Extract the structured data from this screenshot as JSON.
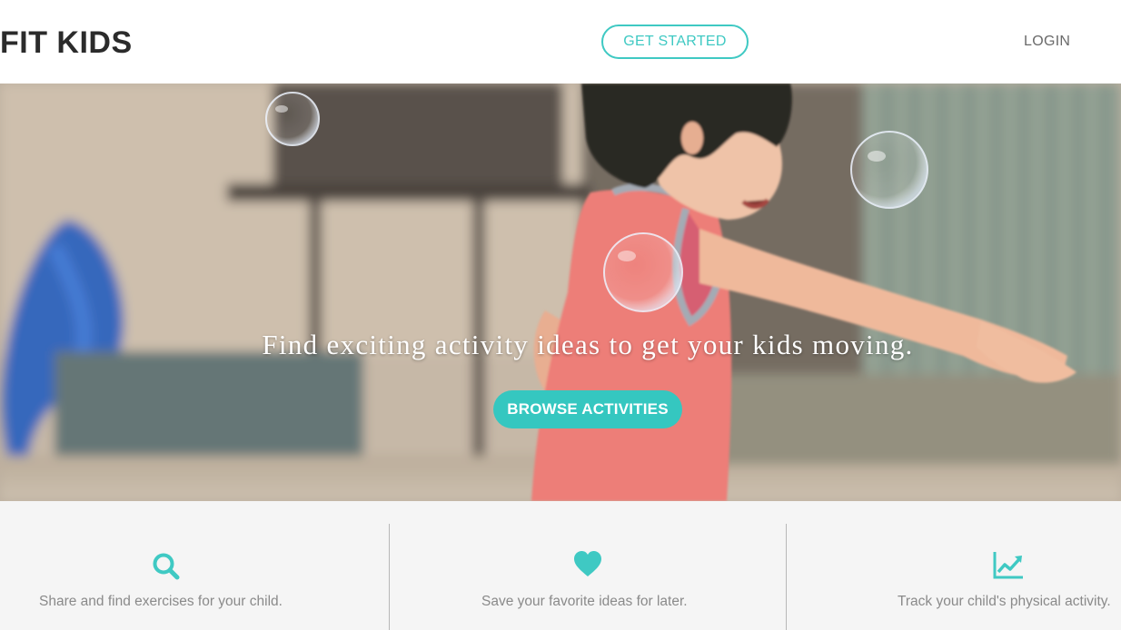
{
  "header": {
    "brand": "FIT KIDS",
    "get_started_label": "GET STARTED",
    "login_label": "LOGIN"
  },
  "hero": {
    "title": "Find exciting activity ideas to get your kids moving.",
    "browse_label": "BROWSE ACTIVITIES"
  },
  "features": [
    {
      "icon": "search-icon",
      "text": "Share and find exercises for your child."
    },
    {
      "icon": "heart-icon",
      "text": "Save your favorite ideas for later."
    },
    {
      "icon": "trending-chart-icon",
      "text": "Track your child's physical activity."
    }
  ],
  "colors": {
    "accent": "#3fc9c3",
    "brand_text": "#2b2b2b",
    "feature_text": "#8a8a8a",
    "features_bg": "#f5f5f5"
  }
}
